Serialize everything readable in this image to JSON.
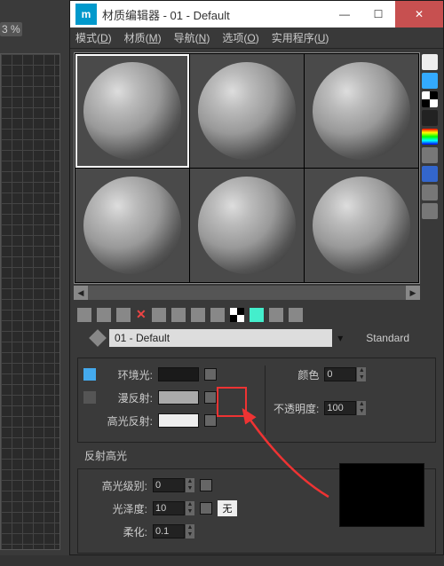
{
  "viewport": {
    "coord_label": "3 %"
  },
  "window": {
    "title": "材质编辑器 - 01 - Default",
    "app_icon": "m"
  },
  "menu": {
    "mode": "模式(",
    "mode_u": "D",
    "mode_end": ")",
    "material": "材质(",
    "material_u": "M",
    "material_end": ")",
    "nav": "导航(",
    "nav_u": "N",
    "nav_end": ")",
    "options": "选项(",
    "options_u": "O",
    "options_end": ")",
    "utilities": "实用程序(",
    "utilities_u": "U",
    "utilities_end": ")"
  },
  "material_name": "01 - Default",
  "standard_label": "Standard",
  "basic": {
    "ambient_label": "环境光:",
    "diffuse_label": "漫反射:",
    "specular_label": "高光反射:",
    "color_label": "颜色",
    "color_value": "0",
    "opacity_label": "不透明度:",
    "opacity_value": "100"
  },
  "highlights": {
    "section_label": "反射高光",
    "level_label": "高光级别:",
    "level_value": "0",
    "gloss_label": "光泽度:",
    "gloss_value": "10",
    "soften_label": "柔化:",
    "soften_value": "0.1",
    "none_label": "无"
  },
  "winbtns": {
    "min": "—",
    "max": "☐",
    "close": "✕"
  },
  "scroll": {
    "left": "◀",
    "right": "▶"
  }
}
